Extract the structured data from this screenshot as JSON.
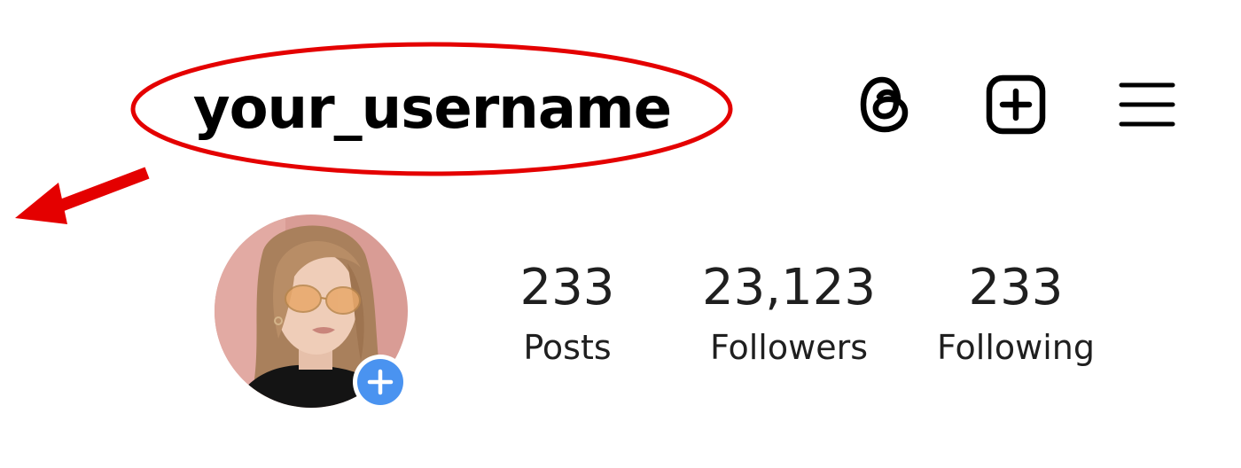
{
  "header": {
    "username": "your_username",
    "icons": [
      "threads-icon",
      "create-post-icon",
      "menu-icon"
    ]
  },
  "profile": {
    "avatar_alt": "profile photo",
    "add_story_icon": "plus-icon"
  },
  "stats": [
    {
      "count": "233",
      "label": "Posts"
    },
    {
      "count": "23,123",
      "label": "Followers"
    },
    {
      "count": "233",
      "label": "Following"
    }
  ],
  "colors": {
    "annotation": "#e40000",
    "badge": "#4a93f0",
    "text": "#1f1f1f"
  }
}
